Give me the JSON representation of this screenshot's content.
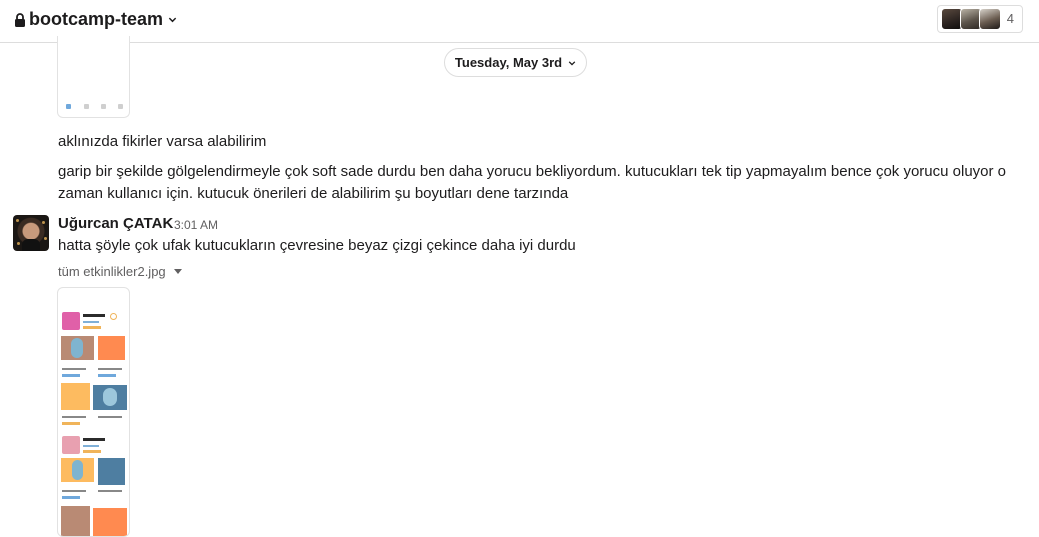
{
  "header": {
    "channel_name": "bootcamp-team",
    "member_count": "4",
    "icons": [
      "lock-icon",
      "chevron-down-icon"
    ]
  },
  "date_divider": {
    "label": "Tuesday, May 3rd"
  },
  "messages": [
    {
      "text": "aklınızda fikirler varsa alabilirim"
    },
    {
      "text": "garip bir şekilde gölgelendirmeyle çok soft sade durdu ben daha yorucu bekliyordum. kutucukları tek tip yapmayalım bence çok yorucu oluyor o zaman kullanıcı için. kutucuk önerileri de alabilirim şu boyutları dene tarzında"
    }
  ],
  "post": {
    "author": "Uğurcan ÇATAK",
    "time": "3:01 AM",
    "text": "hatta şöyle çok ufak kutucukların çevresine beyaz çizgi çekince daha iyi durdu",
    "attachment": {
      "filename": "tüm etkinlikler2.jpg"
    }
  },
  "colors": {
    "pink": "#e060a8",
    "orange": "#ff8a50",
    "peach": "#fdbb60",
    "tan": "#b98a74",
    "steel_blue": "#4e7ea1",
    "border": "#dddddd",
    "muted_text": "#616061"
  }
}
